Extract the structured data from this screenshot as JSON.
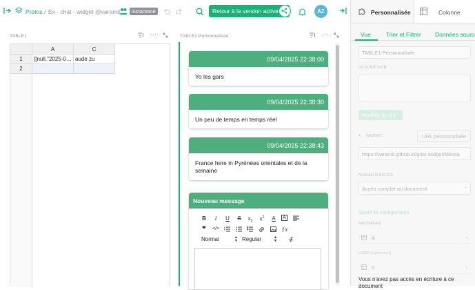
{
  "breadcrumb": {
    "org": "Protos",
    "separator1": "/",
    "doc": "Ex - chat - widget @varamil",
    "badge": "instantané"
  },
  "header": {
    "return_button": "Retour à la version active",
    "avatar_initials": "AZ"
  },
  "table_left": {
    "title": "TABLE1",
    "columns": [
      "A",
      "C"
    ],
    "rows": [
      {
        "num": "1",
        "a": "[[null,\"2025-0…",
        "c": "aude zu"
      },
      {
        "num": "2",
        "a": "",
        "c": ""
      }
    ]
  },
  "widget": {
    "title": "TABLE1 Personnalisée",
    "messages": [
      {
        "time": "09/04/2025 22:38:00",
        "text": "Yo les gars"
      },
      {
        "time": "09/04/2025 22:38:30",
        "text": "Un peu de temps en temps réel"
      },
      {
        "time": "09/04/2025 22:38:43",
        "text": "France here in Pyrénées orientales et de la semaine"
      }
    ],
    "new_message": {
      "title": "Nouveau message",
      "format_select": "Normal",
      "weight_select": "Regular"
    }
  },
  "right_panel": {
    "tabs": [
      {
        "label": "Personnalisée"
      },
      {
        "label": "Colonne"
      }
    ],
    "subtabs": [
      {
        "label": "Vue"
      },
      {
        "label": "Trier et Filtrer"
      },
      {
        "label": "Données source"
      }
    ],
    "view_title_placeholder": "TABLE1 Personnalisée",
    "description_label": "DESCRIPTION",
    "modify_view_button": "Modifier la vue",
    "widget_label": "WIDGET",
    "custom_url_button": "URL personnalisée",
    "url_value": "https://varamil.github.io/grist-widget/Messa",
    "access_label": "NIVEAU D'ACCÈS",
    "access_value": "Accès complet au document",
    "open_config": "Ouvrir la configuration",
    "messages_label": "MESSAGES",
    "messages_value": "A",
    "user_label": "USER",
    "user_optional": "(optionnel)",
    "user_value": "C",
    "footer_text": "Vous n'avez pas accès en écriture à ce document"
  },
  "colors": {
    "accent": "#16b378",
    "message_header": "#4caf7d",
    "avatar": "#5bb6d6"
  }
}
